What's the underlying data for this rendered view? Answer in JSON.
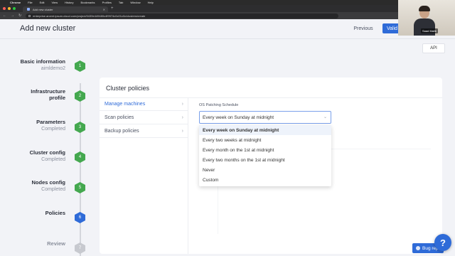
{
  "menubar": {
    "app": "Chrome",
    "items": [
      "File",
      "Edit",
      "View",
      "History",
      "Bookmarks",
      "Profiles",
      "Tab",
      "Window",
      "Help"
    ]
  },
  "browser": {
    "tab_title": "Add new cluster",
    "url": "enterprise.arcent.ipsum.cloud.com/project/0439e449480c4f9974c0c01c0c/clusters/create"
  },
  "header": {
    "title": "Add new cluster",
    "previous_label": "Previous",
    "validate_label": "Valid",
    "webcam_name": "Saad Malik"
  },
  "api_label": "API",
  "steps": [
    {
      "title": "Basic information",
      "sub": "aimldemo2",
      "num": "1",
      "state": "done"
    },
    {
      "title": "Infrastructure profile",
      "sub": "",
      "num": "2",
      "state": "done"
    },
    {
      "title": "Parameters",
      "sub": "Completed",
      "num": "3",
      "state": "done"
    },
    {
      "title": "Cluster config",
      "sub": "Completed",
      "num": "4",
      "state": "done"
    },
    {
      "title": "Nodes config",
      "sub": "Completed",
      "num": "5",
      "state": "done"
    },
    {
      "title": "Policies",
      "sub": "",
      "num": "6",
      "state": "current"
    },
    {
      "title": "Review",
      "sub": "",
      "num": "7",
      "state": "todo"
    }
  ],
  "panel": {
    "title": "Cluster policies",
    "nav": [
      "Manage machines",
      "Scan policies",
      "Backup policies"
    ],
    "field_label": "OS Patching Schedule",
    "selected_value": "Every week on Sunday at midnight",
    "options": [
      "Every week on Sunday at midnight",
      "Every two weeks at midnight",
      "Every month on the 1st at midnight",
      "Every two months on the 1st at midnight",
      "Never",
      "Custom"
    ]
  },
  "bug_label": "Bug rep",
  "help_label": "?",
  "colors": {
    "primary": "#2f6bd8",
    "done": "#44a84f",
    "todo": "#c7c9cf"
  }
}
